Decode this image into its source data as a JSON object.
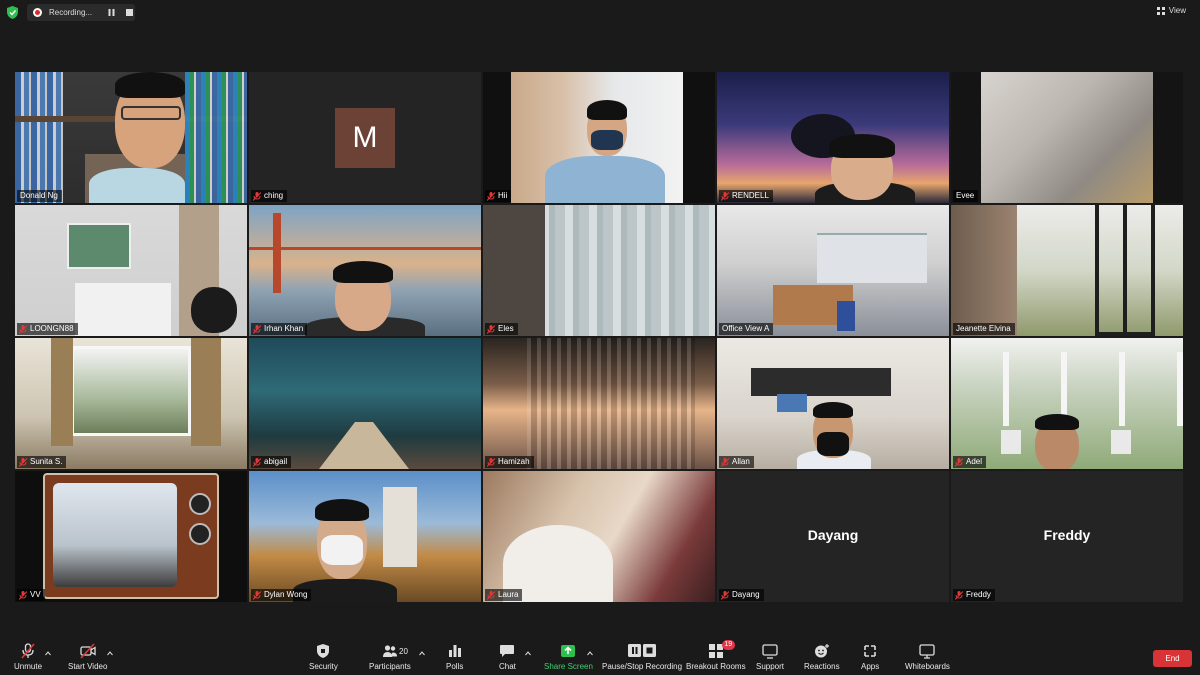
{
  "top": {
    "recording_label": "Recording...",
    "view_label": "View"
  },
  "tiles": [
    {
      "name": "Donald Ng",
      "muted": false
    },
    {
      "name": "ching",
      "muted": true,
      "avatar_letter": "M"
    },
    {
      "name": "Hii",
      "muted": true
    },
    {
      "name": "RENDELL",
      "muted": true
    },
    {
      "name": "Evee",
      "muted": false
    },
    {
      "name": "LOONGN88",
      "muted": true
    },
    {
      "name": "Irhan Khan",
      "muted": true
    },
    {
      "name": "Eles",
      "muted": true
    },
    {
      "name": "Office View A",
      "muted": false
    },
    {
      "name": "Jeanette Elvina",
      "muted": false
    },
    {
      "name": "Sunita S.",
      "muted": true
    },
    {
      "name": "abigail",
      "muted": true
    },
    {
      "name": "Hamizah",
      "muted": true
    },
    {
      "name": "Allan",
      "muted": true
    },
    {
      "name": "Adel",
      "muted": true
    },
    {
      "name": "VV",
      "muted": true
    },
    {
      "name": "Dylan Wong",
      "muted": true
    },
    {
      "name": "Laura",
      "muted": true
    },
    {
      "name": "Dayang",
      "muted": true,
      "display_name": "Dayang"
    },
    {
      "name": "Freddy",
      "muted": true,
      "display_name": "Freddy"
    }
  ],
  "toolbar": {
    "unmute": "Unmute",
    "start_video": "Start Video",
    "security": "Security",
    "participants": "Participants",
    "participants_count": "20",
    "polls": "Polls",
    "chat": "Chat",
    "share_screen": "Share Screen",
    "pause_stop_recording": "Pause/Stop Recording",
    "breakout_rooms": "Breakout Rooms",
    "breakout_badge": "19",
    "support": "Support",
    "reactions": "Reactions",
    "apps": "Apps",
    "whiteboards": "Whiteboards",
    "end": "End"
  },
  "colors": {
    "background": "#1a1a1a",
    "active_speaker_outline": "#c8e04a",
    "end_button": "#d83437",
    "share_screen_green": "#3fd06b",
    "muted_red": "#e0383a",
    "avatar_bg": "#6d4236"
  }
}
